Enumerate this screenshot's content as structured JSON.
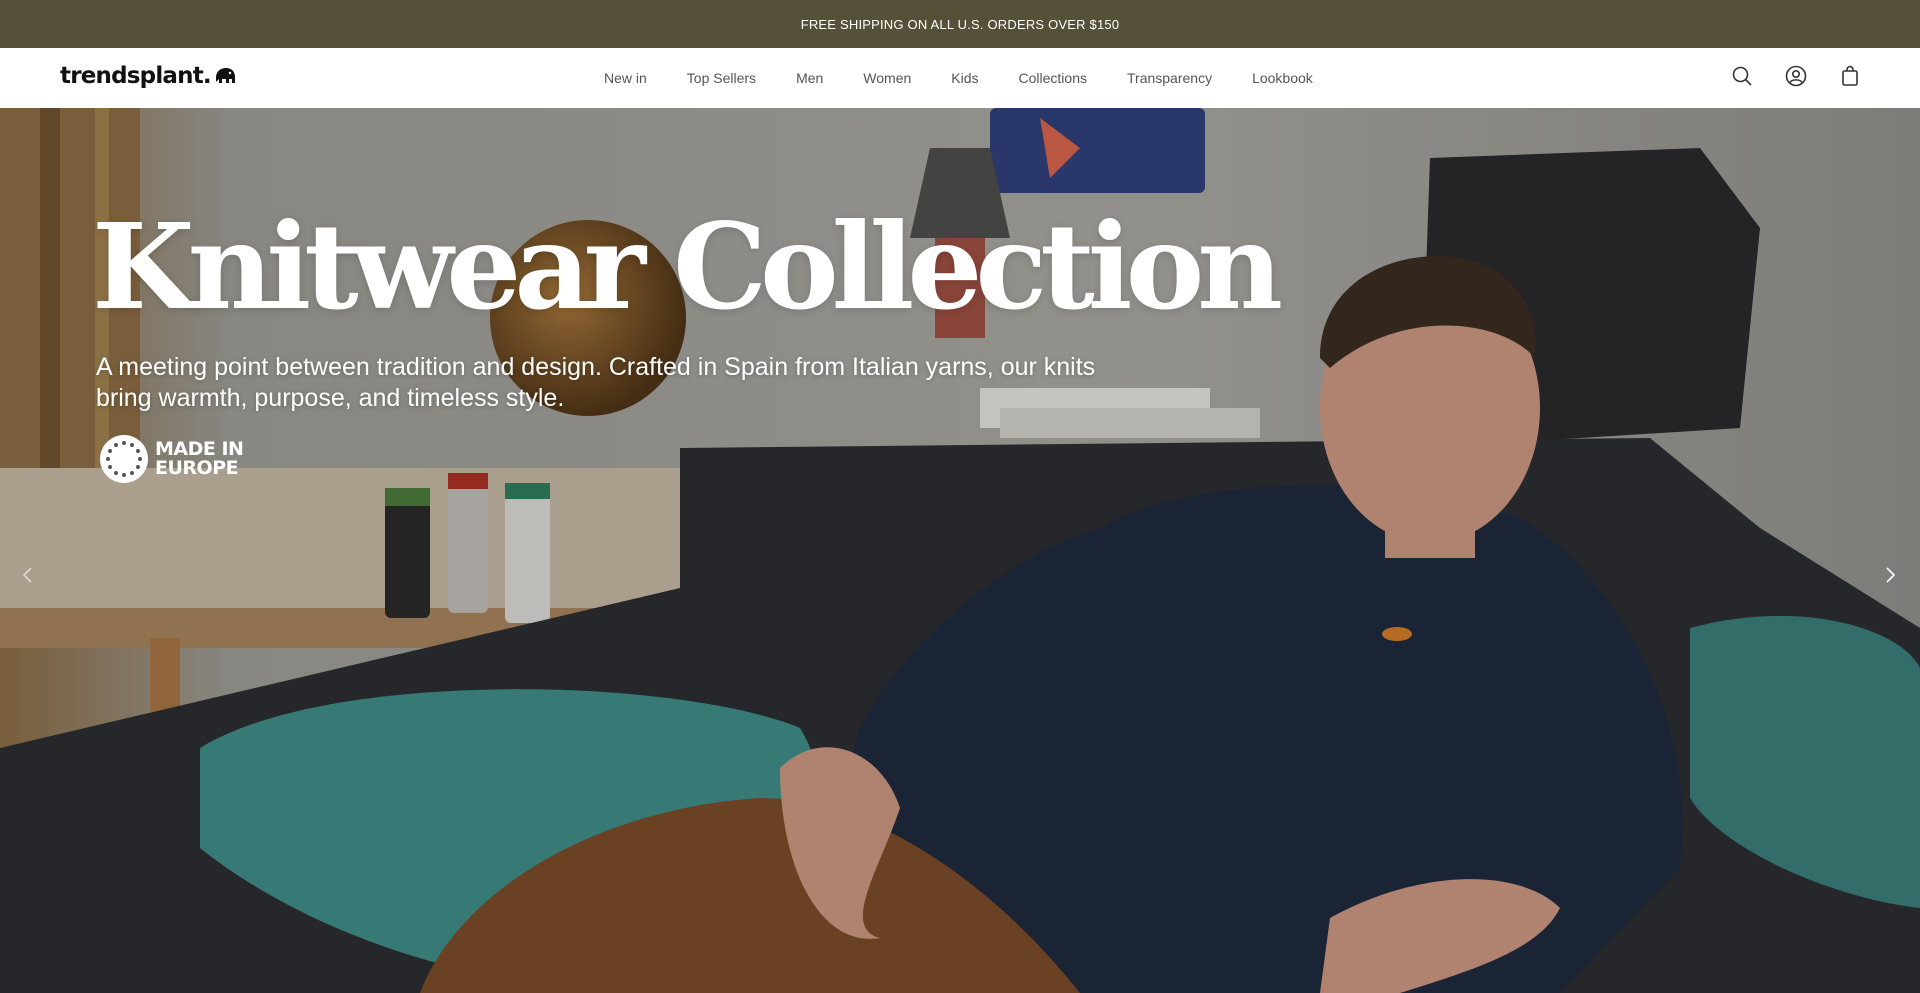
{
  "announcement": {
    "text": "FREE SHIPPING ON ALL U.S. ORDERS OVER $150"
  },
  "header": {
    "logo_text": "trendsplant.",
    "nav": [
      {
        "label": "New in"
      },
      {
        "label": "Top Sellers"
      },
      {
        "label": "Men"
      },
      {
        "label": "Women"
      },
      {
        "label": "Kids"
      },
      {
        "label": "Collections"
      },
      {
        "label": "Transparency"
      },
      {
        "label": "Lookbook"
      }
    ],
    "icons": [
      "search-icon",
      "account-icon",
      "cart-icon"
    ]
  },
  "hero": {
    "title": "Knitwear Collection",
    "subtitle": "A meeting point between tradition and design. Crafted in Spain from Italian yarns, our knits bring warmth, purpose, and timeless style.",
    "badge": {
      "line1": "MADE IN",
      "line2": "EUROPE"
    },
    "prev_icon": "chevron-left-icon",
    "next_icon": "chevron-right-icon"
  },
  "colors": {
    "announcement_bg": "#555038",
    "sweater": "#1f2a3c",
    "pillow": "#3f8a85",
    "pants": "#7a4a2a"
  }
}
